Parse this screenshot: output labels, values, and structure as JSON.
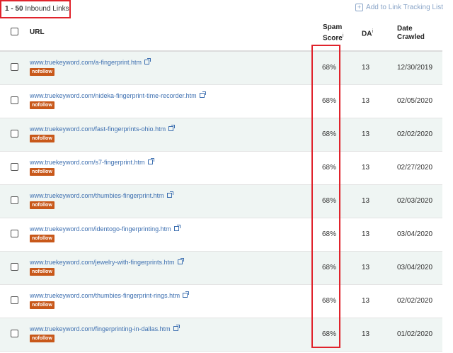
{
  "summary": {
    "range": "1 - 50",
    "label": "Inbound Links"
  },
  "actions": {
    "add_tracking": "Add to Link Tracking List"
  },
  "columns": {
    "url": "URL",
    "spam_line1": "Spam",
    "spam_line2": "Score",
    "da": "DA",
    "date_line1": "Date",
    "date_line2": "Crawled",
    "info_glyph": "i"
  },
  "rows": [
    {
      "url": "www.truekeyword.com/a-fingerprint.htm",
      "badge": "nofollow",
      "spam": "68%",
      "da": "13",
      "date": "12/30/2019"
    },
    {
      "url": "www.truekeyword.com/nideka-fingerprint-time-recorder.htm",
      "badge": "nofollow",
      "spam": "68%",
      "da": "13",
      "date": "02/05/2020"
    },
    {
      "url": "www.truekeyword.com/fast-fingerprints-ohio.htm",
      "badge": "nofollow",
      "spam": "68%",
      "da": "13",
      "date": "02/02/2020"
    },
    {
      "url": "www.truekeyword.com/s7-fingerprint.htm",
      "badge": "nofollow",
      "spam": "68%",
      "da": "13",
      "date": "02/27/2020"
    },
    {
      "url": "www.truekeyword.com/thumbies-fingerprint.htm",
      "badge": "nofollow",
      "spam": "68%",
      "da": "13",
      "date": "02/03/2020"
    },
    {
      "url": "www.truekeyword.com/identogo-fingerprinting.htm",
      "badge": "nofollow",
      "spam": "68%",
      "da": "13",
      "date": "03/04/2020"
    },
    {
      "url": "www.truekeyword.com/jewelry-with-fingerprints.htm",
      "badge": "nofollow",
      "spam": "68%",
      "da": "13",
      "date": "03/04/2020"
    },
    {
      "url": "www.truekeyword.com/thumbies-fingerprint-rings.htm",
      "badge": "nofollow",
      "spam": "68%",
      "da": "13",
      "date": "02/02/2020"
    },
    {
      "url": "www.truekeyword.com/fingerprinting-in-dallas.htm",
      "badge": "nofollow",
      "spam": "68%",
      "da": "13",
      "date": "01/02/2020"
    }
  ],
  "icons": {
    "add": "plus-square-icon",
    "external": "external-link-icon",
    "info": "info-icon"
  },
  "colors": {
    "highlight": "#e0232c",
    "link": "#3d6fb0",
    "badge": "#c8581a",
    "alt_row": "#eff5f3"
  }
}
